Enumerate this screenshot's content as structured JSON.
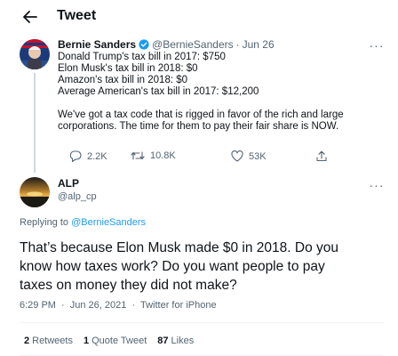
{
  "header": {
    "title": "Tweet"
  },
  "colors": {
    "link": "#1d9bf0",
    "text": "#0f1419",
    "muted": "#536471"
  },
  "original_tweet": {
    "name": "Bernie Sanders",
    "handle": "@BernieSanders",
    "date": "Jun 26",
    "lines": [
      "Donald Trump's tax bill in 2017: $750",
      "Elon Musk's tax bill in 2018: $0",
      "Amazon's tax bill in 2018: $0",
      "Average American's tax bill in 2017: $12,200",
      "We've got a tax code that is rigged in favor of the rich and large",
      "corporations. The time for them to pay their fair share is NOW."
    ],
    "actions": {
      "replies": "2.2K",
      "retweets": "10.8K",
      "likes": "53K"
    }
  },
  "reply_tweet": {
    "name": "ALP",
    "handle": "@alp_cp",
    "replying_prefix": "Replying to",
    "replying_to": "@BernieSanders",
    "lines": [
      "That’s because Elon Musk made $0 in 2018. Do you",
      "know how taxes work? Do you want people to pay",
      "taxes on money they did not make?"
    ],
    "time": "6:29 PM",
    "date": "Jun 26, 2021",
    "source": "Twitter for iPhone",
    "stats": {
      "retweets_count": "2",
      "retweets_label": "Retweets",
      "quotes_count": "1",
      "quotes_label": "Quote Tweet",
      "likes_count": "87",
      "likes_label": "Likes"
    }
  }
}
